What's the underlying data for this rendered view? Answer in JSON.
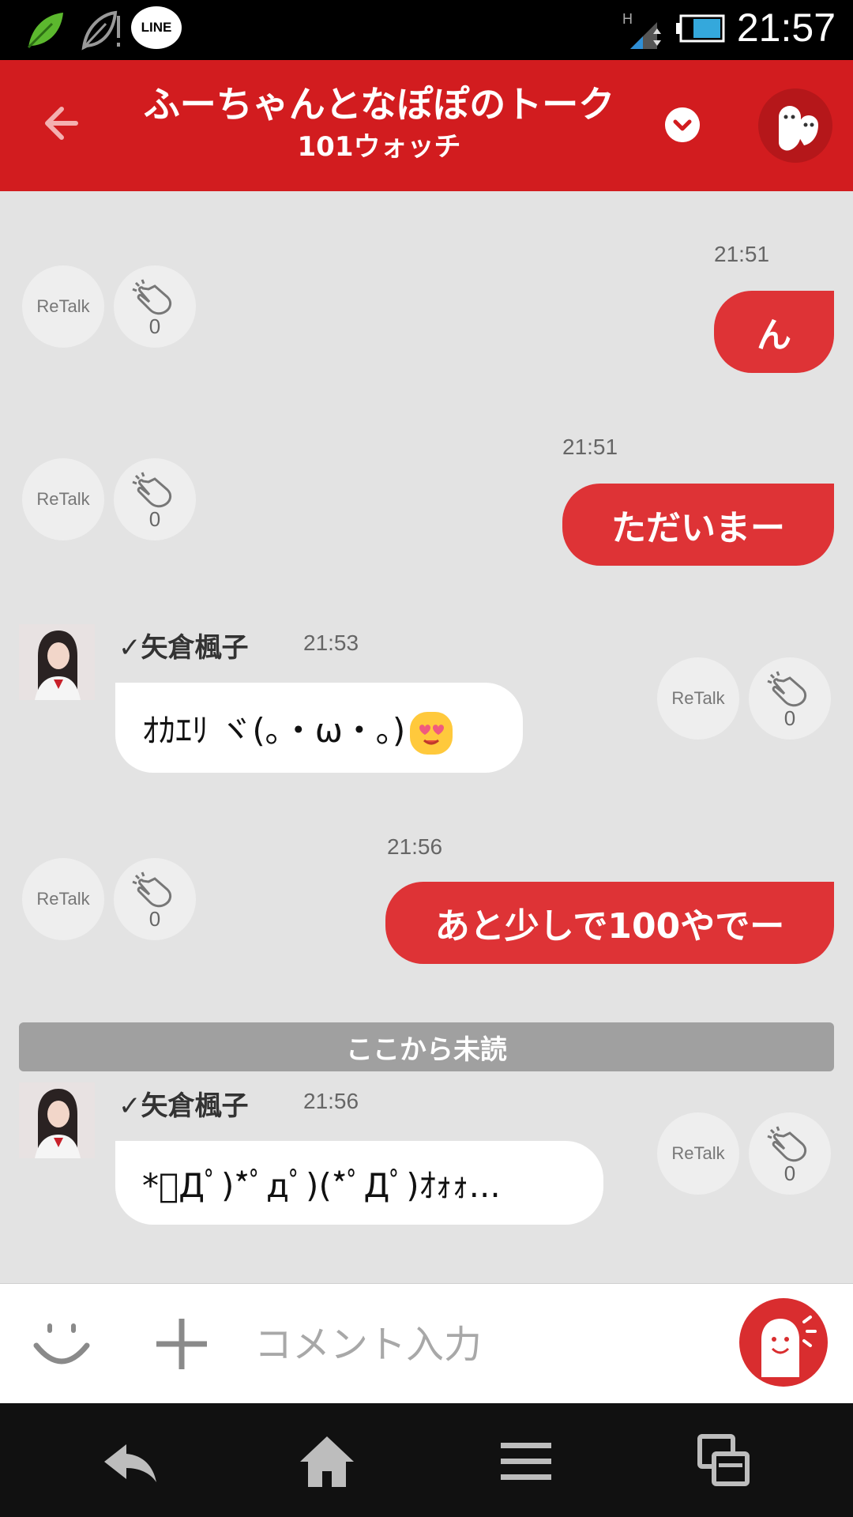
{
  "status_bar": {
    "time": "21:57",
    "line_badge": "LINE",
    "icons": [
      "leaf-icon",
      "leaf-outline-icon",
      "line-icon",
      "signal-icon",
      "battery-icon"
    ]
  },
  "header": {
    "title": "ふーちゃんとなぽぽのトーク",
    "subtitle": "101ウォッチ"
  },
  "messages": [
    {
      "time": "21:51",
      "text": "ん",
      "retalk": "ReTalk",
      "claps": "0"
    },
    {
      "time": "21:51",
      "text": "ただいまー",
      "retalk": "ReTalk",
      "claps": "0"
    },
    {
      "sender": "✓️矢倉楓子",
      "time": "21:53",
      "text": "ｵｶｴﾘ ヾ(｡・ω・｡)",
      "retalk": "ReTalk",
      "claps": "0"
    },
    {
      "time": "21:56",
      "text": "あと少しで100やでー",
      "retalk": "ReTalk",
      "claps": "0"
    },
    {
      "sender": "✓️矢倉楓子",
      "time": "21:56",
      "text": "*ﾟДﾟ)*ﾟдﾟ)(*ﾟДﾟ)ｵｫｫ...",
      "retalk": "ReTalk",
      "claps": "0"
    }
  ],
  "unread_divider": "ここから未読",
  "input_bar": {
    "placeholder": "コメント入力"
  },
  "colors": {
    "brand_red": "#d21c1f",
    "bubble_red": "#de3336",
    "background": "#e3e3e3"
  }
}
